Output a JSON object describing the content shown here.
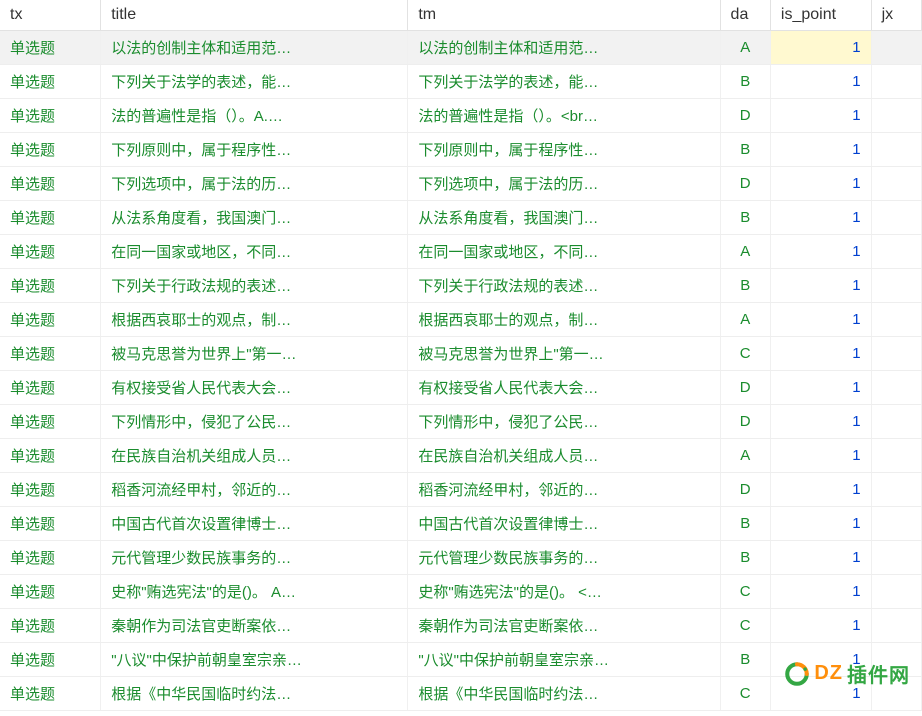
{
  "columns": {
    "tx": "tx",
    "title": "title",
    "tm": "tm",
    "da": "da",
    "is_point": "is_point",
    "jx": "jx"
  },
  "rows": [
    {
      "tx": "单选题",
      "title": "以法的创制主体和适用范…",
      "tm": "以法的创制主体和适用范…",
      "da": "A",
      "is_point": "1",
      "jx": "",
      "selected": true
    },
    {
      "tx": "单选题",
      "title": "下列关于法学的表述，能…",
      "tm": "下列关于法学的表述，能…",
      "da": "B",
      "is_point": "1",
      "jx": ""
    },
    {
      "tx": "单选题",
      "title": "法的普遍性是指（）。A.…",
      "tm": "法的普遍性是指（）。<br…",
      "da": "D",
      "is_point": "1",
      "jx": ""
    },
    {
      "tx": "单选题",
      "title": "下列原则中，属于程序性…",
      "tm": "下列原则中，属于程序性…",
      "da": "B",
      "is_point": "1",
      "jx": ""
    },
    {
      "tx": "单选题",
      "title": "下列选项中，属于法的历…",
      "tm": "下列选项中，属于法的历…",
      "da": "D",
      "is_point": "1",
      "jx": ""
    },
    {
      "tx": "单选题",
      "title": "从法系角度看，我国澳门…",
      "tm": "从法系角度看，我国澳门…",
      "da": "B",
      "is_point": "1",
      "jx": ""
    },
    {
      "tx": "单选题",
      "title": "在同一国家或地区，不同…",
      "tm": "在同一国家或地区，不同…",
      "da": "A",
      "is_point": "1",
      "jx": ""
    },
    {
      "tx": "单选题",
      "title": "下列关于行政法规的表述…",
      "tm": "下列关于行政法规的表述…",
      "da": "B",
      "is_point": "1",
      "jx": ""
    },
    {
      "tx": "单选题",
      "title": "根据西哀耶士的观点，制…",
      "tm": "根据西哀耶士的观点，制…",
      "da": "A",
      "is_point": "1",
      "jx": ""
    },
    {
      "tx": "单选题",
      "title": "被马克思誉为世界上\"第一…",
      "tm": "被马克思誉为世界上\"第一…",
      "da": "C",
      "is_point": "1",
      "jx": ""
    },
    {
      "tx": "单选题",
      "title": "有权接受省人民代表大会…",
      "tm": "有权接受省人民代表大会…",
      "da": "D",
      "is_point": "1",
      "jx": ""
    },
    {
      "tx": "单选题",
      "title": "下列情形中，侵犯了公民…",
      "tm": "下列情形中，侵犯了公民…",
      "da": "D",
      "is_point": "1",
      "jx": ""
    },
    {
      "tx": "单选题",
      "title": "在民族自治机关组成人员…",
      "tm": "在民族自治机关组成人员…",
      "da": "A",
      "is_point": "1",
      "jx": ""
    },
    {
      "tx": "单选题",
      "title": "稻香河流经甲村，邻近的…",
      "tm": "稻香河流经甲村，邻近的…",
      "da": "D",
      "is_point": "1",
      "jx": ""
    },
    {
      "tx": "单选题",
      "title": "中国古代首次设置律博士…",
      "tm": "中国古代首次设置律博士…",
      "da": "B",
      "is_point": "1",
      "jx": ""
    },
    {
      "tx": "单选题",
      "title": "元代管理少数民族事务的…",
      "tm": "元代管理少数民族事务的…",
      "da": "B",
      "is_point": "1",
      "jx": ""
    },
    {
      "tx": "单选题",
      "title": "史称\"贿选宪法\"的是()。 A…",
      "tm": "史称\"贿选宪法\"的是()。 <…",
      "da": "C",
      "is_point": "1",
      "jx": ""
    },
    {
      "tx": "单选题",
      "title": "秦朝作为司法官吏断案依…",
      "tm": "秦朝作为司法官吏断案依…",
      "da": "C",
      "is_point": "1",
      "jx": ""
    },
    {
      "tx": "单选题",
      "title": "\"八议\"中保护前朝皇室宗亲…",
      "tm": "\"八议\"中保护前朝皇室宗亲…",
      "da": "B",
      "is_point": "1",
      "jx": ""
    },
    {
      "tx": "单选题",
      "title": "根据《中华民国临时约法…",
      "tm": "根据《中华民国临时约法…",
      "da": "C",
      "is_point": "1",
      "jx": ""
    }
  ],
  "watermark": {
    "dz": "DZ",
    "rest": "插件网"
  }
}
